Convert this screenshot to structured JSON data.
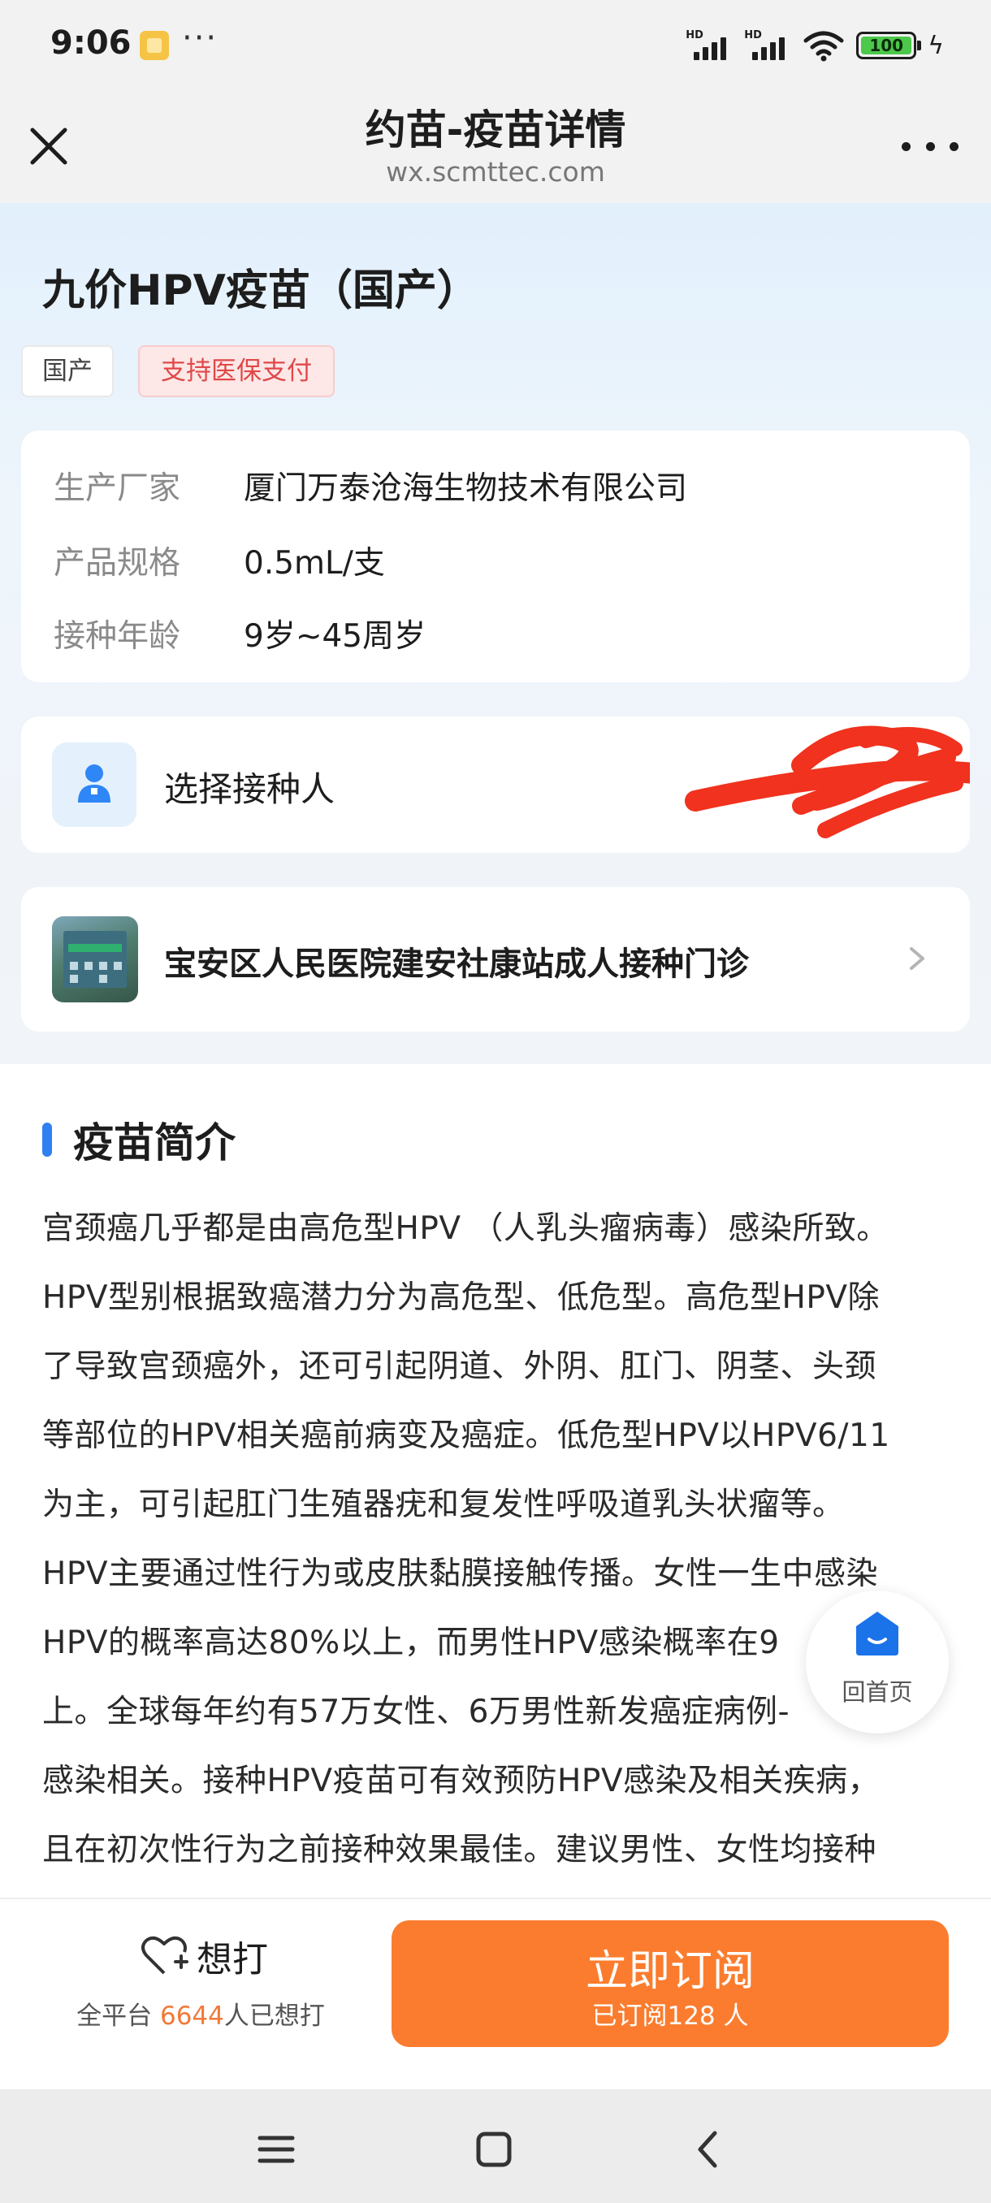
{
  "status_bar": {
    "time": "9:06",
    "more": "···",
    "signal_label": "HD",
    "battery": "100",
    "battery_color": "#4cc84a"
  },
  "nav": {
    "title": "约苗-疫苗详情",
    "url": "wx.scmttec.com",
    "close_icon": "close-icon",
    "menu_icon": "more-icon"
  },
  "product": {
    "name": "九价HPV疫苗（国产）",
    "tags": [
      "国产",
      "支持医保支付"
    ]
  },
  "info": {
    "rows": [
      {
        "key": "生产厂家",
        "value": "厦门万泰沧海生物技术有限公司"
      },
      {
        "key": "产品规格",
        "value": "0.5mL/支"
      },
      {
        "key": "接种年龄",
        "value": "9岁~45周岁"
      }
    ]
  },
  "person": {
    "label": "选择接种人",
    "icon": "person-icon"
  },
  "clinic": {
    "name": "宝安区人民医院建安社康站成人接种门诊",
    "icon": "chevron-right-icon"
  },
  "intro": {
    "title": "疫苗简介",
    "accent_color": "#2f80f0",
    "lines": [
      "宫颈癌几乎都是由高危型HPV （人乳头瘤病毒）感染所致。",
      "HPV型别根据致癌潜力分为高危型、低危型。高危型HPV除",
      "了导致宫颈癌外，还可引起阴道、外阴、肛门、阴茎、头颈",
      "等部位的HPV相关癌前病变及癌症。低危型HPV以HPV6/11",
      "为主，可引起肛门生殖器疣和复发性呼吸道乳头状瘤等。",
      "HPV主要通过性行为或皮肤黏膜接触传播。女性一生中感染",
      "HPV的概率高达80%以上，而男性HPV感染概率在9",
      "上。全球每年约有57万女性、6万男性新发癌症病例-",
      "感染相关。接种HPV疫苗可有效预防HPV感染及相关疾病，",
      "且在初次性行为之前接种效果最佳。建议男性、女性均接种"
    ]
  },
  "float_home": {
    "label": "回首页",
    "icon": "home-icon",
    "color": "#1a73e8"
  },
  "action_bar": {
    "want_label": "想打",
    "want_icon": "heart-plus-icon",
    "count_prefix": "全平台",
    "count": "6644",
    "count_suffix": "人已想打",
    "subscribe_label": "立即订阅",
    "subscribe_sub": "已订阅128 人",
    "subscribe_color": "#fb7c2e"
  },
  "system_nav": {
    "icons": [
      "menu-icon",
      "home-square-icon",
      "back-icon"
    ]
  }
}
